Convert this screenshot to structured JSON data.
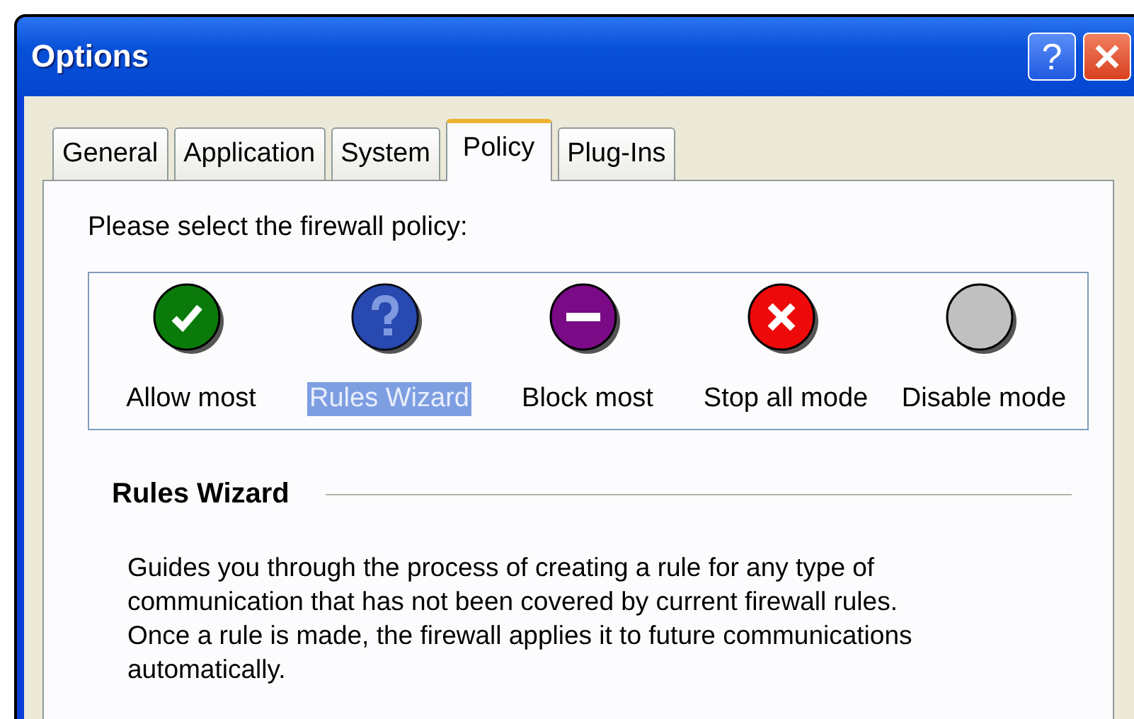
{
  "window": {
    "title": "Options"
  },
  "title_buttons": [
    {
      "kind": "help",
      "label": "?"
    },
    {
      "kind": "close"
    }
  ],
  "tabs": [
    {
      "label": "General",
      "selected": false
    },
    {
      "label": "Application",
      "selected": false
    },
    {
      "label": "System",
      "selected": false
    },
    {
      "label": "Policy",
      "selected": true
    },
    {
      "label": "Plug-Ins",
      "selected": false
    }
  ],
  "prompt": "Please select the firewall policy:",
  "policies": [
    {
      "kind": "allow",
      "label": "Allow most",
      "selected": false
    },
    {
      "kind": "wizard",
      "label": "Rules Wizard",
      "selected": true
    },
    {
      "kind": "block",
      "label": "Block most",
      "selected": false
    },
    {
      "kind": "stop",
      "label": "Stop all mode",
      "selected": false
    },
    {
      "kind": "disable",
      "label": "Disable mode",
      "selected": false
    }
  ],
  "section": {
    "heading": "Rules Wizard",
    "description": "Guides you through the process of creating a rule for any type of communication that has not been covered by current firewall rules. Once a rule is made, the firewall applies it to future communications automatically."
  }
}
